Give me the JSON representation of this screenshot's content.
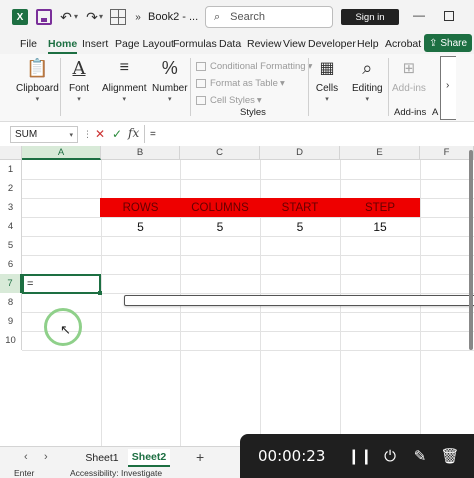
{
  "titlebar": {
    "logo": "X",
    "doc_title": "Book2 - ...",
    "search_placeholder": "Search",
    "signin_label": "Sign in",
    "min_glyph": "—"
  },
  "menu": {
    "tabs": [
      "File",
      "Home",
      "Insert",
      "Page Layout",
      "Formulas",
      "Data",
      "Review",
      "View",
      "Developer",
      "Help",
      "Acrobat"
    ],
    "active_tab": "Home",
    "share_label": "Share"
  },
  "ribbon": {
    "clipboard": "Clipboard",
    "font": "Font",
    "alignment": "Alignment",
    "number": "Number",
    "conditional_formatting": "Conditional Formatting",
    "format_as_table": "Format as Table",
    "cell_styles": "Cell Styles",
    "styles_group": "Styles",
    "cells": "Cells",
    "editing": "Editing",
    "addins": "Add-ins",
    "addins_group": "Add-ins",
    "ad_group": "A"
  },
  "formula_bar": {
    "name_box": "SUM",
    "content": "="
  },
  "grid": {
    "columns": [
      "A",
      "B",
      "C",
      "D",
      "E",
      "F"
    ],
    "rows": [
      "1",
      "2",
      "3",
      "4",
      "5",
      "6",
      "7",
      "8",
      "9",
      "10"
    ],
    "headers": [
      "ROWS",
      "COLUMNS",
      "START",
      "STEP"
    ],
    "values": [
      "5",
      "5",
      "5",
      "15"
    ],
    "active_cell_text": "="
  },
  "sheets": {
    "tabs": [
      "Sheet1",
      "Sheet2"
    ],
    "active": "Sheet2",
    "add_label": "+"
  },
  "status": {
    "mode": "Enter",
    "accessibility": "Accessibility: Investigate"
  },
  "recorder": {
    "time": "00:00:23"
  },
  "colors": {
    "brand": "#1d6f42",
    "header_fill": "#ee0000",
    "header_text": "#660000"
  }
}
